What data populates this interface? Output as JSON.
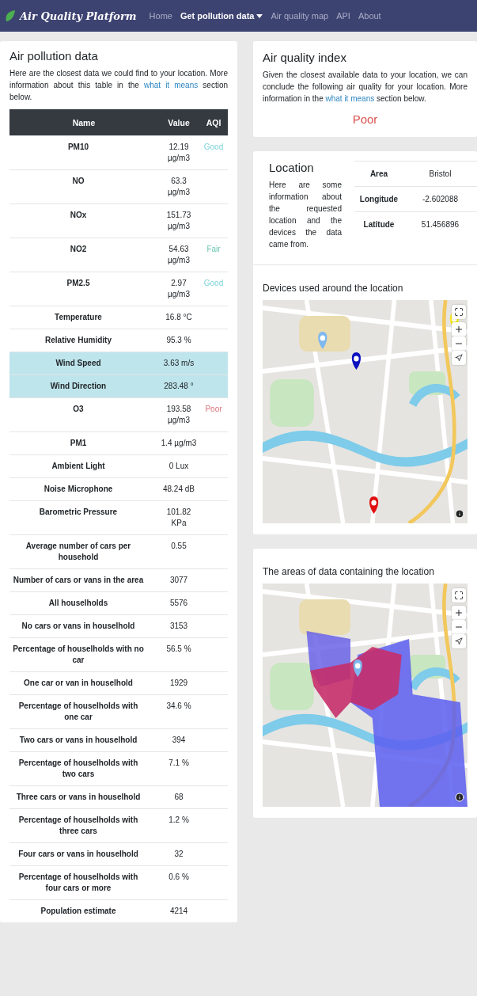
{
  "navbar": {
    "brand": "Air Quality Platform",
    "items": [
      {
        "label": "Home",
        "selected": false,
        "dropdown": false
      },
      {
        "label": "Get pollution data",
        "selected": true,
        "dropdown": true
      },
      {
        "label": "Air quality map",
        "selected": false,
        "dropdown": false
      },
      {
        "label": "API",
        "selected": false,
        "dropdown": false
      },
      {
        "label": "About",
        "selected": false,
        "dropdown": false
      }
    ]
  },
  "pollution": {
    "title": "Air pollution data",
    "intro": "Here are the closest data we could find to your location. More information about this table in the",
    "link": "what it means",
    "intro_end": "section below.",
    "columns": [
      "Name",
      "Value",
      "AQI"
    ],
    "rows": [
      {
        "name": "PM10",
        "value": "12.19 µg/m3",
        "aqi": "Good",
        "color": "#7dd3d8",
        "highlighted": false
      },
      {
        "name": "NO",
        "value": "63.3 µg/m3",
        "highlighted": false
      },
      {
        "name": "NOx",
        "value": "151.73 µg/m3",
        "highlighted": false
      },
      {
        "name": "NO2",
        "value": "54.63 µg/m3",
        "aqi": "Fair",
        "color": "#6cc3b0",
        "highlighted": false
      },
      {
        "name": "PM2.5",
        "value": "2.97 µg/m3",
        "aqi": "Good",
        "color": "#7dd3d8",
        "highlighted": false
      },
      {
        "name": "Temperature",
        "value": "16.8 °C",
        "highlighted": false
      },
      {
        "name": "Relative Humidity",
        "value": "95.3 %",
        "highlighted": false
      },
      {
        "name": "Wind Speed",
        "value": "3.63 m/s",
        "highlighted": true
      },
      {
        "name": "Wind Direction",
        "value": "283.48 °",
        "highlighted": true
      },
      {
        "name": "O3",
        "value": "193.58 µg/m3",
        "aqi": "Poor",
        "color": "#d9737a",
        "highlighted": false
      },
      {
        "name": "PM1",
        "value": "1.4 µg/m3",
        "highlighted": false
      },
      {
        "name": "Ambient Light",
        "value": "0 Lux",
        "highlighted": false
      },
      {
        "name": "Noise Microphone",
        "value": "48.24 dB",
        "highlighted": false
      },
      {
        "name": "Barometric Pressure",
        "value": "101.82 KPa",
        "highlighted": false
      },
      {
        "name": "Average number of cars per household",
        "value": "0.55",
        "highlighted": false
      },
      {
        "name": "Number of cars or vans in the area",
        "value": "3077",
        "highlighted": false
      },
      {
        "name": "All houselholds",
        "value": "5576",
        "highlighted": false
      },
      {
        "name": "No cars or vans in houselhold",
        "value": "3153",
        "highlighted": false
      },
      {
        "name": "Percentage of houselholds with no car",
        "value": "56.5 %",
        "highlighted": false
      },
      {
        "name": "One car or van in houselhold",
        "value": "1929",
        "highlighted": false
      },
      {
        "name": "Percentage of houselholds with one car",
        "value": "34.6 %",
        "highlighted": false
      },
      {
        "name": "Two cars or vans in houselhold",
        "value": "394",
        "highlighted": false
      },
      {
        "name": "Percentage of houselholds with two cars",
        "value": "7.1 %",
        "highlighted": false
      },
      {
        "name": "Three cars or vans in houselhold",
        "value": "68",
        "highlighted": false
      },
      {
        "name": "Percentage of houselholds with three cars",
        "value": "1.2 %",
        "highlighted": false
      },
      {
        "name": "Four cars or vans in houselhold",
        "value": "32",
        "highlighted": false
      },
      {
        "name": "Percentage of houselholds with four cars or more",
        "value": "0.6 %",
        "highlighted": false
      },
      {
        "name": "Population estimate",
        "value": "4214",
        "highlighted": false
      }
    ]
  },
  "aqi_card": {
    "title": "Air quality index",
    "intro": "Given the closest available data to your location, we can conclude the following air quality for your location. More information in the",
    "link": "what it means",
    "intro_end": "section below.",
    "result": "Poor",
    "color": "#d9534f"
  },
  "location": {
    "title": "Location",
    "text": "Here are some information about the requested location and the devices the data came from.",
    "rows": [
      {
        "label": "Area",
        "value": "Bristol"
      },
      {
        "label": "Longitude",
        "value": "-2.602088"
      },
      {
        "label": "Latitude",
        "value": "51.456896"
      }
    ]
  },
  "devices_map": {
    "title": "Devices used around the location",
    "kind": "picture"
  },
  "areas_map": {
    "title": "The areas of data containing the location",
    "kind": "picture"
  }
}
